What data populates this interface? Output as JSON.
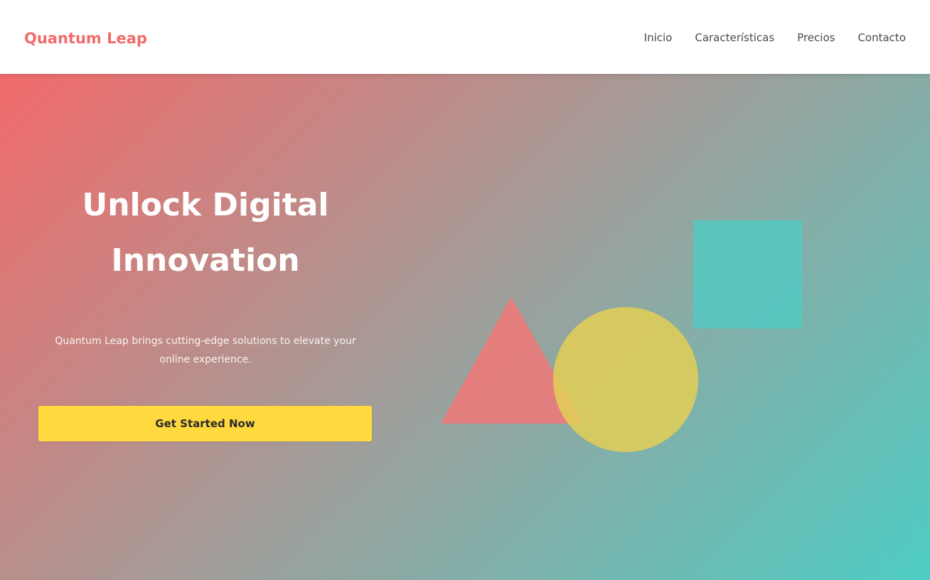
{
  "brand": {
    "name": "Quantum Leap"
  },
  "nav": {
    "items": [
      {
        "label": "Inicio"
      },
      {
        "label": "Características"
      },
      {
        "label": "Precios"
      },
      {
        "label": "Contacto"
      }
    ]
  },
  "hero": {
    "title": "Unlock Digital\nInnovation",
    "subtitle": "Quantum Leap brings cutting-edge solutions to elevate your online experience.",
    "cta_label": "Get Started Now"
  },
  "colors": {
    "brand": "#f26b6b",
    "gradient_start": "#f26b6b",
    "gradient_end": "#4ecdc4",
    "cta": "#ffd93d",
    "triangle": "#e97b7b",
    "circle": "#e3cf55",
    "square": "#56c8c0"
  },
  "icons": {
    "decor_triangle": "triangle-shape",
    "decor_circle": "circle-shape",
    "decor_square": "square-shape"
  }
}
